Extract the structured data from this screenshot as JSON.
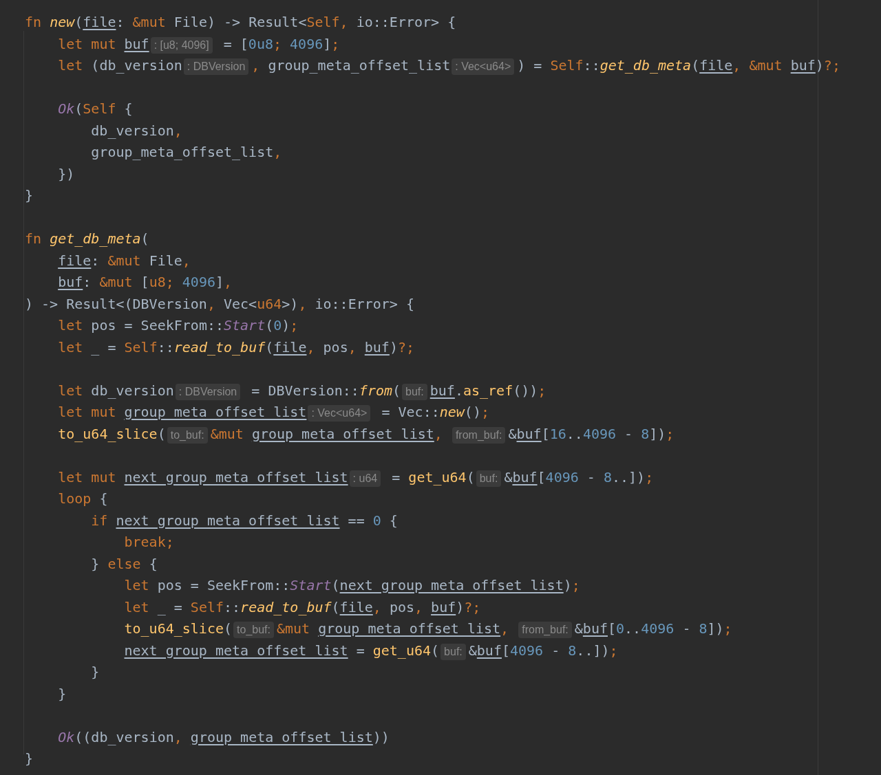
{
  "editor": {
    "lines": [
      {
        "kind": "code",
        "tokens": [
          {
            "kind": "keyword",
            "text": "fn "
          },
          {
            "kind": "fn-italic",
            "text": "new"
          },
          {
            "kind": "plain",
            "text": "("
          },
          {
            "kind": "mut-var",
            "text": "file"
          },
          {
            "kind": "plain",
            "text": ": "
          },
          {
            "kind": "keyword",
            "text": "&mut "
          },
          {
            "kind": "plain",
            "text": "File) -> Result<"
          },
          {
            "kind": "keyword",
            "text": "Self"
          },
          {
            "kind": "keyword",
            "text": ", "
          },
          {
            "kind": "plain",
            "text": "io::Error> {"
          }
        ]
      },
      {
        "kind": "code",
        "tokens": [
          {
            "kind": "keyword",
            "text": "    let mut "
          },
          {
            "kind": "mut-var",
            "text": "buf"
          },
          {
            "kind": "hint",
            "text": ": [u8; 4096]"
          },
          {
            "kind": "plain",
            "text": " = ["
          },
          {
            "kind": "number",
            "text": "0u8"
          },
          {
            "kind": "keyword",
            "text": "; "
          },
          {
            "kind": "number",
            "text": "4096"
          },
          {
            "kind": "plain",
            "text": "]"
          },
          {
            "kind": "keyword",
            "text": ";"
          }
        ]
      },
      {
        "kind": "code",
        "tokens": [
          {
            "kind": "keyword",
            "text": "    let "
          },
          {
            "kind": "plain",
            "text": "(db_version"
          },
          {
            "kind": "hint",
            "text": ": DBVersion"
          },
          {
            "kind": "keyword",
            "text": ", "
          },
          {
            "kind": "plain",
            "text": "group_meta_offset_list"
          },
          {
            "kind": "hint",
            "text": ": Vec<u64>"
          },
          {
            "kind": "plain",
            "text": ") = "
          },
          {
            "kind": "keyword",
            "text": "Self"
          },
          {
            "kind": "plain",
            "text": "::"
          },
          {
            "kind": "fn-italic",
            "text": "get_db_meta"
          },
          {
            "kind": "plain",
            "text": "("
          },
          {
            "kind": "mut-var",
            "text": "file"
          },
          {
            "kind": "keyword",
            "text": ", "
          },
          {
            "kind": "keyword",
            "text": "&mut "
          },
          {
            "kind": "mut-var",
            "text": "buf"
          },
          {
            "kind": "plain",
            "text": ")"
          },
          {
            "kind": "keyword",
            "text": "?;"
          }
        ]
      },
      {
        "kind": "blank"
      },
      {
        "kind": "code",
        "tokens": [
          {
            "kind": "variant",
            "text": "    Ok"
          },
          {
            "kind": "plain",
            "text": "("
          },
          {
            "kind": "keyword",
            "text": "Self"
          },
          {
            "kind": "plain",
            "text": " {"
          }
        ]
      },
      {
        "kind": "code",
        "tokens": [
          {
            "kind": "plain",
            "text": "        db_version"
          },
          {
            "kind": "keyword",
            "text": ","
          }
        ]
      },
      {
        "kind": "code",
        "tokens": [
          {
            "kind": "plain",
            "text": "        group_meta_offset_list"
          },
          {
            "kind": "keyword",
            "text": ","
          }
        ]
      },
      {
        "kind": "code",
        "tokens": [
          {
            "kind": "plain",
            "text": "    })"
          }
        ]
      },
      {
        "kind": "code",
        "tokens": [
          {
            "kind": "plain",
            "text": "}"
          }
        ]
      },
      {
        "kind": "blank"
      },
      {
        "kind": "code",
        "tokens": [
          {
            "kind": "keyword",
            "text": "fn "
          },
          {
            "kind": "fn-italic",
            "text": "get_db_meta"
          },
          {
            "kind": "plain",
            "text": "("
          }
        ]
      },
      {
        "kind": "code",
        "tokens": [
          {
            "kind": "mut-var",
            "text": "    file"
          },
          {
            "kind": "plain",
            "text": ": "
          },
          {
            "kind": "keyword",
            "text": "&mut "
          },
          {
            "kind": "plain",
            "text": "File"
          },
          {
            "kind": "keyword",
            "text": ","
          }
        ]
      },
      {
        "kind": "code",
        "tokens": [
          {
            "kind": "mut-var",
            "text": "    buf"
          },
          {
            "kind": "plain",
            "text": ": "
          },
          {
            "kind": "keyword",
            "text": "&mut "
          },
          {
            "kind": "plain",
            "text": "["
          },
          {
            "kind": "keyword",
            "text": "u8; "
          },
          {
            "kind": "number",
            "text": "4096"
          },
          {
            "kind": "plain",
            "text": "]"
          },
          {
            "kind": "keyword",
            "text": ","
          }
        ]
      },
      {
        "kind": "code",
        "tokens": [
          {
            "kind": "plain",
            "text": ") -> Result<(DBVersion"
          },
          {
            "kind": "keyword",
            "text": ", "
          },
          {
            "kind": "plain",
            "text": "Vec<"
          },
          {
            "kind": "keyword",
            "text": "u64"
          },
          {
            "kind": "plain",
            "text": ">)"
          },
          {
            "kind": "keyword",
            "text": ", "
          },
          {
            "kind": "plain",
            "text": "io::Error> {"
          }
        ]
      },
      {
        "kind": "code",
        "tokens": [
          {
            "kind": "keyword",
            "text": "    let "
          },
          {
            "kind": "plain",
            "text": "pos = SeekFrom::"
          },
          {
            "kind": "variant",
            "text": "Start"
          },
          {
            "kind": "plain",
            "text": "("
          },
          {
            "kind": "number",
            "text": "0"
          },
          {
            "kind": "plain",
            "text": ")"
          },
          {
            "kind": "keyword",
            "text": ";"
          }
        ]
      },
      {
        "kind": "code",
        "tokens": [
          {
            "kind": "keyword",
            "text": "    let "
          },
          {
            "kind": "plain",
            "text": "_ = "
          },
          {
            "kind": "keyword",
            "text": "Self"
          },
          {
            "kind": "plain",
            "text": "::"
          },
          {
            "kind": "fn-italic",
            "text": "read_to_buf"
          },
          {
            "kind": "plain",
            "text": "("
          },
          {
            "kind": "mut-var",
            "text": "file"
          },
          {
            "kind": "keyword",
            "text": ", "
          },
          {
            "kind": "plain",
            "text": "pos"
          },
          {
            "kind": "keyword",
            "text": ", "
          },
          {
            "kind": "mut-var",
            "text": "buf"
          },
          {
            "kind": "plain",
            "text": ")"
          },
          {
            "kind": "keyword",
            "text": "?;"
          }
        ]
      },
      {
        "kind": "blank"
      },
      {
        "kind": "code",
        "tokens": [
          {
            "kind": "keyword",
            "text": "    let "
          },
          {
            "kind": "plain",
            "text": "db_version"
          },
          {
            "kind": "hint",
            "text": ": DBVersion"
          },
          {
            "kind": "plain",
            "text": " = DBVersion::"
          },
          {
            "kind": "fn-italic",
            "text": "from"
          },
          {
            "kind": "plain",
            "text": "("
          },
          {
            "kind": "hint",
            "text": "buf:"
          },
          {
            "kind": "mut-var",
            "text": "buf"
          },
          {
            "kind": "plain",
            "text": "."
          },
          {
            "kind": "fn",
            "text": "as_ref"
          },
          {
            "kind": "plain",
            "text": "())"
          },
          {
            "kind": "keyword",
            "text": ";"
          }
        ]
      },
      {
        "kind": "code",
        "tokens": [
          {
            "kind": "keyword",
            "text": "    let mut "
          },
          {
            "kind": "mut-var",
            "text": "group_meta_offset_list"
          },
          {
            "kind": "hint",
            "text": ": Vec<u64>"
          },
          {
            "kind": "plain",
            "text": " = Vec::"
          },
          {
            "kind": "fn-italic",
            "text": "new"
          },
          {
            "kind": "plain",
            "text": "()"
          },
          {
            "kind": "keyword",
            "text": ";"
          }
        ]
      },
      {
        "kind": "code",
        "tokens": [
          {
            "kind": "fn",
            "text": "    to_u64_slice"
          },
          {
            "kind": "plain",
            "text": "("
          },
          {
            "kind": "hint",
            "text": "to_buf:"
          },
          {
            "kind": "keyword",
            "text": "&mut "
          },
          {
            "kind": "mut-var",
            "text": "group_meta_offset_list"
          },
          {
            "kind": "keyword",
            "text": ", "
          },
          {
            "kind": "hint",
            "text": "from_buf:"
          },
          {
            "kind": "plain",
            "text": "&"
          },
          {
            "kind": "mut-var",
            "text": "buf"
          },
          {
            "kind": "plain",
            "text": "["
          },
          {
            "kind": "number",
            "text": "16"
          },
          {
            "kind": "plain",
            "text": ".."
          },
          {
            "kind": "number",
            "text": "4096"
          },
          {
            "kind": "plain",
            "text": " - "
          },
          {
            "kind": "number",
            "text": "8"
          },
          {
            "kind": "plain",
            "text": "])"
          },
          {
            "kind": "keyword",
            "text": ";"
          }
        ]
      },
      {
        "kind": "blank"
      },
      {
        "kind": "code",
        "tokens": [
          {
            "kind": "keyword",
            "text": "    let mut "
          },
          {
            "kind": "mut-var",
            "text": "next_group_meta_offset_list"
          },
          {
            "kind": "hint",
            "text": ": u64"
          },
          {
            "kind": "plain",
            "text": " = "
          },
          {
            "kind": "fn",
            "text": "get_u64"
          },
          {
            "kind": "plain",
            "text": "("
          },
          {
            "kind": "hint",
            "text": "buf:"
          },
          {
            "kind": "plain",
            "text": "&"
          },
          {
            "kind": "mut-var",
            "text": "buf"
          },
          {
            "kind": "plain",
            "text": "["
          },
          {
            "kind": "number",
            "text": "4096"
          },
          {
            "kind": "plain",
            "text": " - "
          },
          {
            "kind": "number",
            "text": "8"
          },
          {
            "kind": "plain",
            "text": "..])"
          },
          {
            "kind": "keyword",
            "text": ";"
          }
        ]
      },
      {
        "kind": "code",
        "tokens": [
          {
            "kind": "keyword",
            "text": "    loop "
          },
          {
            "kind": "plain",
            "text": "{"
          }
        ]
      },
      {
        "kind": "code",
        "tokens": [
          {
            "kind": "keyword",
            "text": "        if "
          },
          {
            "kind": "mut-var",
            "text": "next_group_meta_offset_list"
          },
          {
            "kind": "plain",
            "text": " == "
          },
          {
            "kind": "number",
            "text": "0"
          },
          {
            "kind": "plain",
            "text": " {"
          }
        ]
      },
      {
        "kind": "code",
        "tokens": [
          {
            "kind": "keyword",
            "text": "            break;"
          }
        ]
      },
      {
        "kind": "code",
        "tokens": [
          {
            "kind": "plain",
            "text": "        } "
          },
          {
            "kind": "keyword",
            "text": "else "
          },
          {
            "kind": "plain",
            "text": "{"
          }
        ]
      },
      {
        "kind": "code",
        "tokens": [
          {
            "kind": "keyword",
            "text": "            let "
          },
          {
            "kind": "plain",
            "text": "pos = SeekFrom::"
          },
          {
            "kind": "variant",
            "text": "Start"
          },
          {
            "kind": "plain",
            "text": "("
          },
          {
            "kind": "mut-var",
            "text": "next_group_meta_offset_list"
          },
          {
            "kind": "plain",
            "text": ")"
          },
          {
            "kind": "keyword",
            "text": ";"
          }
        ]
      },
      {
        "kind": "code",
        "tokens": [
          {
            "kind": "keyword",
            "text": "            let "
          },
          {
            "kind": "plain",
            "text": "_ = "
          },
          {
            "kind": "keyword",
            "text": "Self"
          },
          {
            "kind": "plain",
            "text": "::"
          },
          {
            "kind": "fn-italic",
            "text": "read_to_buf"
          },
          {
            "kind": "plain",
            "text": "("
          },
          {
            "kind": "mut-var",
            "text": "file"
          },
          {
            "kind": "keyword",
            "text": ", "
          },
          {
            "kind": "plain",
            "text": "pos"
          },
          {
            "kind": "keyword",
            "text": ", "
          },
          {
            "kind": "mut-var",
            "text": "buf"
          },
          {
            "kind": "plain",
            "text": ")"
          },
          {
            "kind": "keyword",
            "text": "?;"
          }
        ]
      },
      {
        "kind": "code",
        "tokens": [
          {
            "kind": "fn",
            "text": "            to_u64_slice"
          },
          {
            "kind": "plain",
            "text": "("
          },
          {
            "kind": "hint",
            "text": "to_buf:"
          },
          {
            "kind": "keyword",
            "text": "&mut "
          },
          {
            "kind": "mut-var",
            "text": "group_meta_offset_list"
          },
          {
            "kind": "keyword",
            "text": ", "
          },
          {
            "kind": "hint",
            "text": "from_buf:"
          },
          {
            "kind": "plain",
            "text": "&"
          },
          {
            "kind": "mut-var",
            "text": "buf"
          },
          {
            "kind": "plain",
            "text": "["
          },
          {
            "kind": "number",
            "text": "0"
          },
          {
            "kind": "plain",
            "text": ".."
          },
          {
            "kind": "number",
            "text": "4096"
          },
          {
            "kind": "plain",
            "text": " - "
          },
          {
            "kind": "number",
            "text": "8"
          },
          {
            "kind": "plain",
            "text": "])"
          },
          {
            "kind": "keyword",
            "text": ";"
          }
        ]
      },
      {
        "kind": "code",
        "tokens": [
          {
            "kind": "mut-var",
            "text": "            next_group_meta_offset_list"
          },
          {
            "kind": "plain",
            "text": " = "
          },
          {
            "kind": "fn",
            "text": "get_u64"
          },
          {
            "kind": "plain",
            "text": "("
          },
          {
            "kind": "hint",
            "text": "buf:"
          },
          {
            "kind": "plain",
            "text": "&"
          },
          {
            "kind": "mut-var",
            "text": "buf"
          },
          {
            "kind": "plain",
            "text": "["
          },
          {
            "kind": "number",
            "text": "4096"
          },
          {
            "kind": "plain",
            "text": " - "
          },
          {
            "kind": "number",
            "text": "8"
          },
          {
            "kind": "plain",
            "text": "..])"
          },
          {
            "kind": "keyword",
            "text": ";"
          }
        ]
      },
      {
        "kind": "code",
        "tokens": [
          {
            "kind": "plain",
            "text": "        }"
          }
        ]
      },
      {
        "kind": "code",
        "tokens": [
          {
            "kind": "plain",
            "text": "    }"
          }
        ]
      },
      {
        "kind": "blank"
      },
      {
        "kind": "code",
        "tokens": [
          {
            "kind": "variant",
            "text": "    Ok"
          },
          {
            "kind": "plain",
            "text": "((db_version"
          },
          {
            "kind": "keyword",
            "text": ", "
          },
          {
            "kind": "mut-var",
            "text": "group_meta_offset_list"
          },
          {
            "kind": "plain",
            "text": "))"
          }
        ]
      },
      {
        "kind": "code",
        "tokens": [
          {
            "kind": "plain",
            "text": "}"
          }
        ]
      }
    ]
  }
}
